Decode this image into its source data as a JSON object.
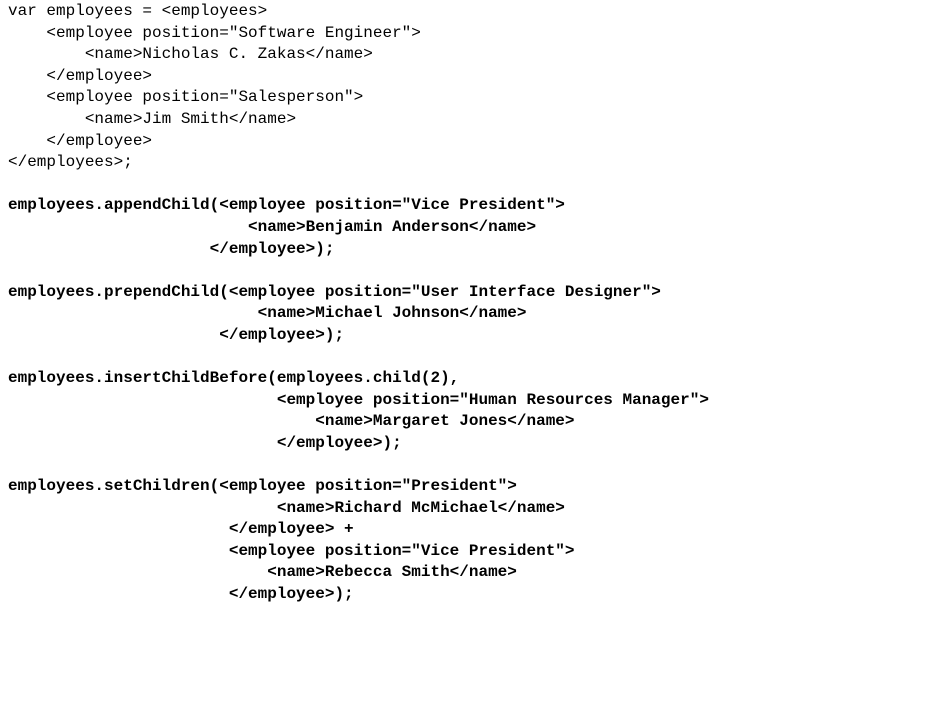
{
  "code_listing": {
    "lines": [
      {
        "text": "var employees = <employees>",
        "bold": false
      },
      {
        "text": "    <employee position=\"Software Engineer\">",
        "bold": false
      },
      {
        "text": "        <name>Nicholas C. Zakas</name>",
        "bold": false
      },
      {
        "text": "    </employee>",
        "bold": false
      },
      {
        "text": "    <employee position=\"Salesperson\">",
        "bold": false
      },
      {
        "text": "        <name>Jim Smith</name>",
        "bold": false
      },
      {
        "text": "    </employee>",
        "bold": false
      },
      {
        "text": "</employees>;",
        "bold": false
      },
      {
        "text": "",
        "bold": false
      },
      {
        "text": "employees.appendChild(<employee position=\"Vice President\">",
        "bold": true
      },
      {
        "text": "                         <name>Benjamin Anderson</name>",
        "bold": true
      },
      {
        "text": "                     </employee>);",
        "bold": true
      },
      {
        "text": "",
        "bold": false
      },
      {
        "text": "employees.prependChild(<employee position=\"User Interface Designer\">",
        "bold": true
      },
      {
        "text": "                          <name>Michael Johnson</name>",
        "bold": true
      },
      {
        "text": "                      </employee>);",
        "bold": true
      },
      {
        "text": "",
        "bold": false
      },
      {
        "text": "employees.insertChildBefore(employees.child(2),",
        "bold": true
      },
      {
        "text": "                            <employee position=\"Human Resources Manager\">",
        "bold": true
      },
      {
        "text": "                                <name>Margaret Jones</name>",
        "bold": true
      },
      {
        "text": "                            </employee>);",
        "bold": true
      },
      {
        "text": "",
        "bold": false
      },
      {
        "text": "employees.setChildren(<employee position=\"President\">",
        "bold": true
      },
      {
        "text": "                            <name>Richard McMichael</name>",
        "bold": true
      },
      {
        "text": "                       </employee> +",
        "bold": true
      },
      {
        "text": "                       <employee position=\"Vice President\">",
        "bold": true
      },
      {
        "text": "                           <name>Rebecca Smith</name>",
        "bold": true
      },
      {
        "text": "                       </employee>);",
        "bold": true
      }
    ]
  }
}
